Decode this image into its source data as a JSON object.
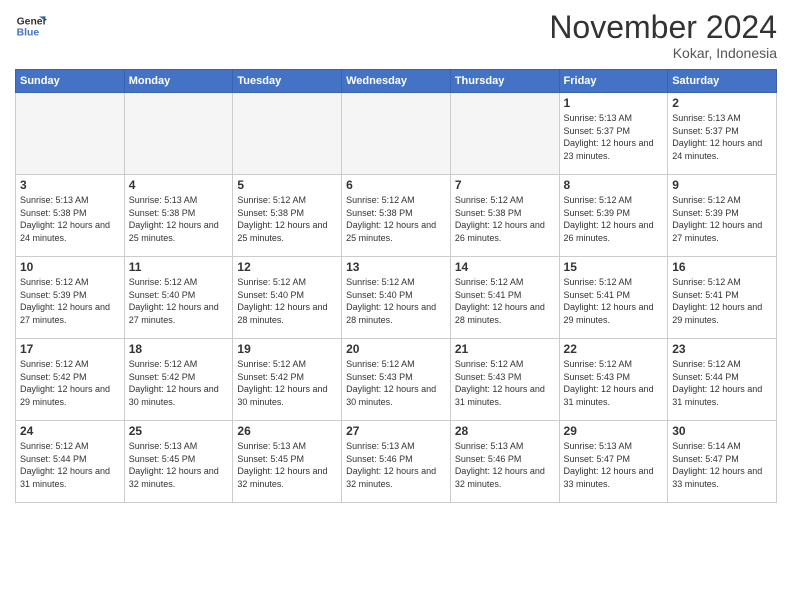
{
  "header": {
    "logo_line1": "General",
    "logo_line2": "Blue",
    "month": "November 2024",
    "location": "Kokar, Indonesia"
  },
  "weekdays": [
    "Sunday",
    "Monday",
    "Tuesday",
    "Wednesday",
    "Thursday",
    "Friday",
    "Saturday"
  ],
  "weeks": [
    [
      {
        "day": "",
        "info": ""
      },
      {
        "day": "",
        "info": ""
      },
      {
        "day": "",
        "info": ""
      },
      {
        "day": "",
        "info": ""
      },
      {
        "day": "",
        "info": ""
      },
      {
        "day": "1",
        "info": "Sunrise: 5:13 AM\nSunset: 5:37 PM\nDaylight: 12 hours and 23 minutes."
      },
      {
        "day": "2",
        "info": "Sunrise: 5:13 AM\nSunset: 5:37 PM\nDaylight: 12 hours and 24 minutes."
      }
    ],
    [
      {
        "day": "3",
        "info": "Sunrise: 5:13 AM\nSunset: 5:38 PM\nDaylight: 12 hours and 24 minutes."
      },
      {
        "day": "4",
        "info": "Sunrise: 5:13 AM\nSunset: 5:38 PM\nDaylight: 12 hours and 25 minutes."
      },
      {
        "day": "5",
        "info": "Sunrise: 5:12 AM\nSunset: 5:38 PM\nDaylight: 12 hours and 25 minutes."
      },
      {
        "day": "6",
        "info": "Sunrise: 5:12 AM\nSunset: 5:38 PM\nDaylight: 12 hours and 25 minutes."
      },
      {
        "day": "7",
        "info": "Sunrise: 5:12 AM\nSunset: 5:38 PM\nDaylight: 12 hours and 26 minutes."
      },
      {
        "day": "8",
        "info": "Sunrise: 5:12 AM\nSunset: 5:39 PM\nDaylight: 12 hours and 26 minutes."
      },
      {
        "day": "9",
        "info": "Sunrise: 5:12 AM\nSunset: 5:39 PM\nDaylight: 12 hours and 27 minutes."
      }
    ],
    [
      {
        "day": "10",
        "info": "Sunrise: 5:12 AM\nSunset: 5:39 PM\nDaylight: 12 hours and 27 minutes."
      },
      {
        "day": "11",
        "info": "Sunrise: 5:12 AM\nSunset: 5:40 PM\nDaylight: 12 hours and 27 minutes."
      },
      {
        "day": "12",
        "info": "Sunrise: 5:12 AM\nSunset: 5:40 PM\nDaylight: 12 hours and 28 minutes."
      },
      {
        "day": "13",
        "info": "Sunrise: 5:12 AM\nSunset: 5:40 PM\nDaylight: 12 hours and 28 minutes."
      },
      {
        "day": "14",
        "info": "Sunrise: 5:12 AM\nSunset: 5:41 PM\nDaylight: 12 hours and 28 minutes."
      },
      {
        "day": "15",
        "info": "Sunrise: 5:12 AM\nSunset: 5:41 PM\nDaylight: 12 hours and 29 minutes."
      },
      {
        "day": "16",
        "info": "Sunrise: 5:12 AM\nSunset: 5:41 PM\nDaylight: 12 hours and 29 minutes."
      }
    ],
    [
      {
        "day": "17",
        "info": "Sunrise: 5:12 AM\nSunset: 5:42 PM\nDaylight: 12 hours and 29 minutes."
      },
      {
        "day": "18",
        "info": "Sunrise: 5:12 AM\nSunset: 5:42 PM\nDaylight: 12 hours and 30 minutes."
      },
      {
        "day": "19",
        "info": "Sunrise: 5:12 AM\nSunset: 5:42 PM\nDaylight: 12 hours and 30 minutes."
      },
      {
        "day": "20",
        "info": "Sunrise: 5:12 AM\nSunset: 5:43 PM\nDaylight: 12 hours and 30 minutes."
      },
      {
        "day": "21",
        "info": "Sunrise: 5:12 AM\nSunset: 5:43 PM\nDaylight: 12 hours and 31 minutes."
      },
      {
        "day": "22",
        "info": "Sunrise: 5:12 AM\nSunset: 5:43 PM\nDaylight: 12 hours and 31 minutes."
      },
      {
        "day": "23",
        "info": "Sunrise: 5:12 AM\nSunset: 5:44 PM\nDaylight: 12 hours and 31 minutes."
      }
    ],
    [
      {
        "day": "24",
        "info": "Sunrise: 5:12 AM\nSunset: 5:44 PM\nDaylight: 12 hours and 31 minutes."
      },
      {
        "day": "25",
        "info": "Sunrise: 5:13 AM\nSunset: 5:45 PM\nDaylight: 12 hours and 32 minutes."
      },
      {
        "day": "26",
        "info": "Sunrise: 5:13 AM\nSunset: 5:45 PM\nDaylight: 12 hours and 32 minutes."
      },
      {
        "day": "27",
        "info": "Sunrise: 5:13 AM\nSunset: 5:46 PM\nDaylight: 12 hours and 32 minutes."
      },
      {
        "day": "28",
        "info": "Sunrise: 5:13 AM\nSunset: 5:46 PM\nDaylight: 12 hours and 32 minutes."
      },
      {
        "day": "29",
        "info": "Sunrise: 5:13 AM\nSunset: 5:47 PM\nDaylight: 12 hours and 33 minutes."
      },
      {
        "day": "30",
        "info": "Sunrise: 5:14 AM\nSunset: 5:47 PM\nDaylight: 12 hours and 33 minutes."
      }
    ]
  ]
}
